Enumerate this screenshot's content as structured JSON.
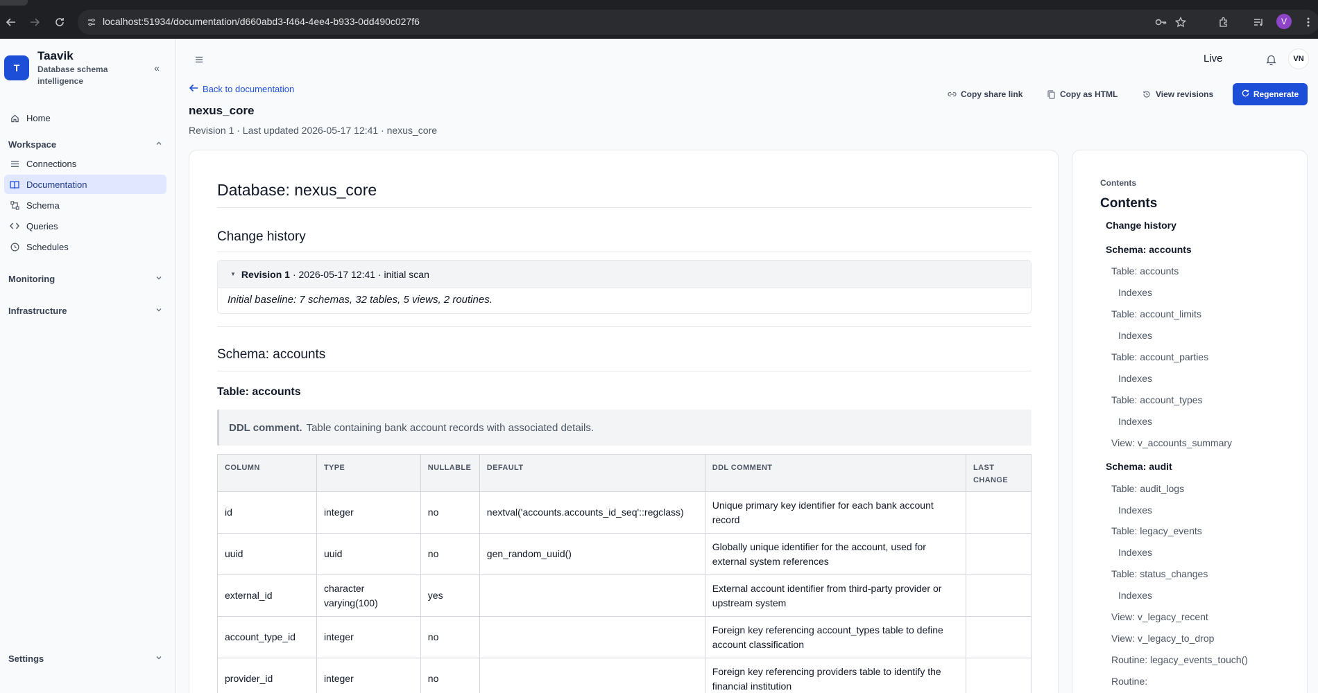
{
  "browser": {
    "url": "localhost:51934/documentation/d660abd3-f464-4ee4-b933-0dd490c027f6",
    "profile_initial": "V"
  },
  "sidebar": {
    "logo_letter": "T",
    "brand_name": "Taavik",
    "brand_sub": "Database schema intelligence",
    "home": "Home",
    "workspace_label": "Workspace",
    "workspace_items": [
      {
        "label": "Connections",
        "icon": "list-icon"
      },
      {
        "label": "Documentation",
        "icon": "book-icon",
        "active": true
      },
      {
        "label": "Schema",
        "icon": "schema-icon"
      },
      {
        "label": "Queries",
        "icon": "code-icon"
      },
      {
        "label": "Schedules",
        "icon": "clock-icon"
      }
    ],
    "monitoring_label": "Monitoring",
    "infrastructure_label": "Infrastructure",
    "settings_label": "Settings"
  },
  "header": {
    "status": "Live",
    "user_initials": "VN"
  },
  "doc": {
    "back_label": "Back to documentation",
    "title": "nexus_core",
    "meta": "Revision 1 · Last updated 2026-05-17 12:41 · nexus_core",
    "actions": {
      "copy_share": "Copy share link",
      "copy_html": "Copy as HTML",
      "view_revisions": "View revisions",
      "regenerate": "Regenerate"
    }
  },
  "content": {
    "db_heading": "Database: nexus_core",
    "change_history_heading": "Change history",
    "revision": {
      "label": "Revision 1",
      "detail": "· 2026-05-17 12:41 · initial scan",
      "body": "Initial baseline: 7 schemas, 32 tables, 5 views, 2 routines."
    },
    "schema_heading": "Schema: accounts",
    "table_heading": "Table: accounts",
    "ddl_label": "DDL comment.",
    "ddl_text": "Table containing bank account records with associated details.",
    "columns_header": [
      "COLUMN",
      "TYPE",
      "NULLABLE",
      "DEFAULT",
      "DDL COMMENT",
      "LAST CHANGE"
    ],
    "rows": [
      {
        "column": "id",
        "type": "integer",
        "nullable": "no",
        "default": "nextval('accounts.accounts_id_seq'::regclass)",
        "comment": "Unique primary key identifier for each bank account record",
        "last_change": ""
      },
      {
        "column": "uuid",
        "type": "uuid",
        "nullable": "no",
        "default": "gen_random_uuid()",
        "comment": "Globally unique identifier for the account, used for external system references",
        "last_change": ""
      },
      {
        "column": "external_id",
        "type": "character varying(100)",
        "nullable": "yes",
        "default": "",
        "comment": "External account identifier from third-party provider or upstream system",
        "last_change": ""
      },
      {
        "column": "account_type_id",
        "type": "integer",
        "nullable": "no",
        "default": "",
        "comment": "Foreign key referencing account_types table to define account classification",
        "last_change": ""
      },
      {
        "column": "provider_id",
        "type": "integer",
        "nullable": "no",
        "default": "",
        "comment": "Foreign key referencing providers table to identify the financial institution",
        "last_change": ""
      }
    ]
  },
  "toc": {
    "kicker": "Contents",
    "title": "Contents",
    "items": [
      {
        "label": "Change history",
        "level": 1
      },
      {
        "label": "Schema: accounts",
        "level": 1
      },
      {
        "label": "Table: accounts",
        "level": 2
      },
      {
        "label": "Indexes",
        "level": 3
      },
      {
        "label": "Table: account_limits",
        "level": 2
      },
      {
        "label": "Indexes",
        "level": 3
      },
      {
        "label": "Table: account_parties",
        "level": 2
      },
      {
        "label": "Indexes",
        "level": 3
      },
      {
        "label": "Table: account_types",
        "level": 2
      },
      {
        "label": "Indexes",
        "level": 3
      },
      {
        "label": "View: v_accounts_summary",
        "level": 2
      },
      {
        "label": "Schema: audit",
        "level": 1
      },
      {
        "label": "Table: audit_logs",
        "level": 2
      },
      {
        "label": "Indexes",
        "level": 3
      },
      {
        "label": "Table: legacy_events",
        "level": 2
      },
      {
        "label": "Indexes",
        "level": 3
      },
      {
        "label": "Table: status_changes",
        "level": 2
      },
      {
        "label": "Indexes",
        "level": 3
      },
      {
        "label": "View: v_legacy_recent",
        "level": 2
      },
      {
        "label": "View: v_legacy_to_drop",
        "level": 2
      },
      {
        "label": "Routine: legacy_events_touch()",
        "level": 2
      },
      {
        "label": "Routine:",
        "level": 2
      }
    ]
  }
}
